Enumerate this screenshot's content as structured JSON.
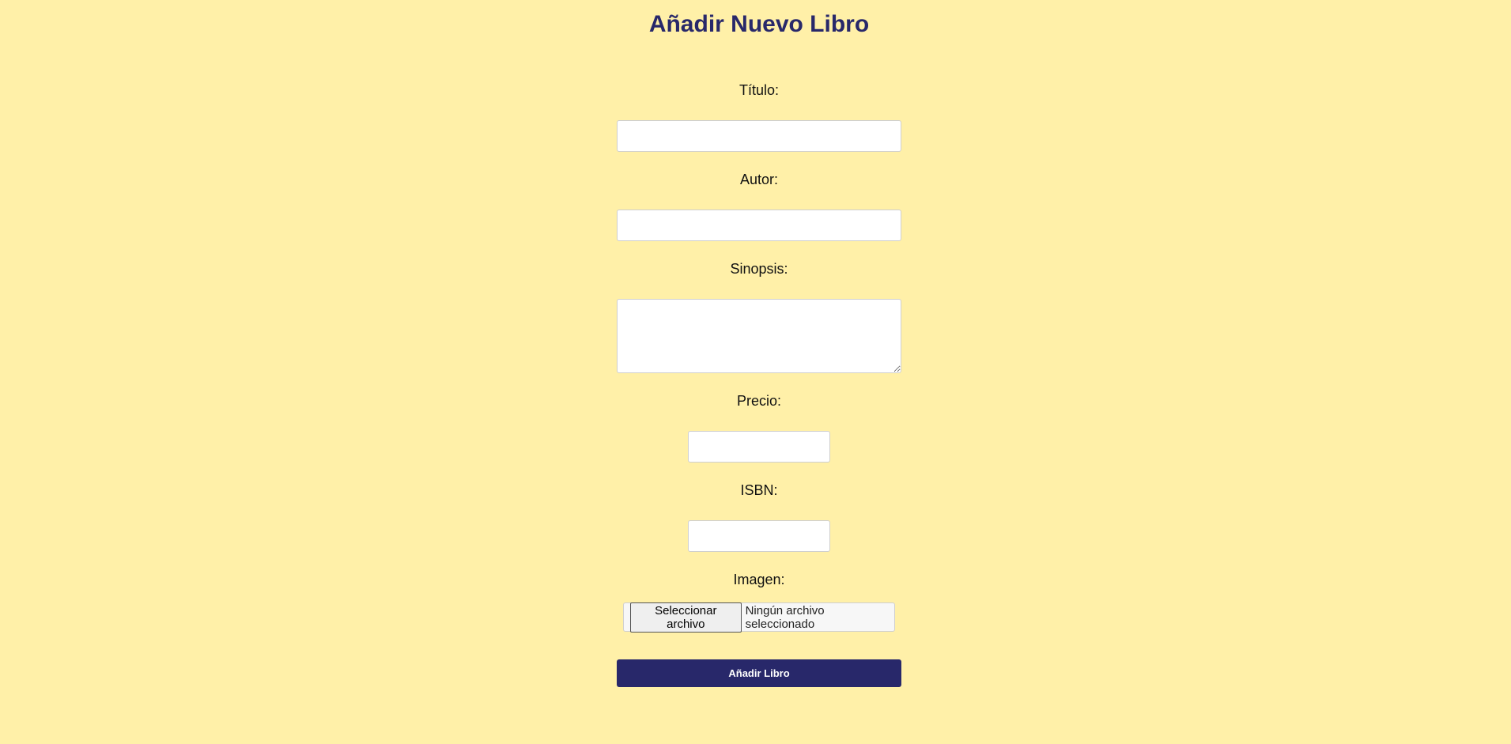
{
  "page": {
    "title": "Añadir Nuevo Libro"
  },
  "form": {
    "titulo": {
      "label": "Título:",
      "value": "",
      "placeholder": ""
    },
    "autor": {
      "label": "Autor:",
      "value": "",
      "placeholder": ""
    },
    "sinopsis": {
      "label": "Sinopsis:",
      "value": "",
      "placeholder": ""
    },
    "precio": {
      "label": "Precio:",
      "value": "",
      "placeholder": ""
    },
    "isbn": {
      "label": "ISBN:",
      "value": "",
      "placeholder": ""
    },
    "imagen": {
      "label": "Imagen:",
      "button_label": "Seleccionar archivo",
      "status": "Ningún archivo seleccionado"
    },
    "submit_label": "Añadir Libro"
  },
  "colors": {
    "background": "#fff0a8",
    "accent": "#28286a"
  }
}
